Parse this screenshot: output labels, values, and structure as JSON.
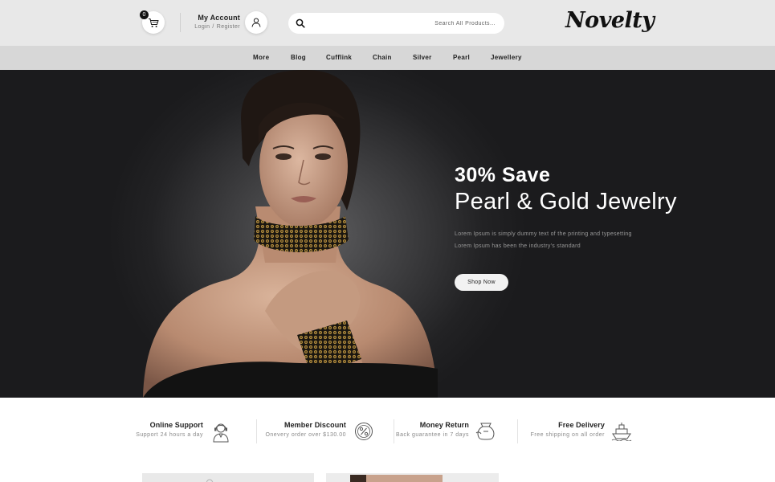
{
  "header": {
    "cart_count": "0",
    "account_title": "My Account",
    "login_label": "Login",
    "link_separator": "/",
    "register_label": "Register",
    "search_placeholder": "Search All Products...",
    "logo_text": "Novelty"
  },
  "nav": {
    "items": [
      {
        "label": "More"
      },
      {
        "label": "Blog"
      },
      {
        "label": "Cufflink"
      },
      {
        "label": "Chain"
      },
      {
        "label": "Silver"
      },
      {
        "label": "Pearl"
      },
      {
        "label": "Jewellery"
      }
    ]
  },
  "hero": {
    "save_text": "30% Save",
    "title": "Pearl & Gold Jewelry",
    "line1": "Lorem Ipsum is simply dummy text of the printing and typesetting",
    "line2": "Lorem Ipsum has been the industry's standard",
    "button_label": "Shop Now"
  },
  "features": [
    {
      "title": "Online Support",
      "subtitle": "Support 24 hours a day",
      "icon": "support-icon"
    },
    {
      "title": "Member Discount",
      "subtitle": "Onevery order over $130.00",
      "icon": "discount-icon"
    },
    {
      "title": "Money Return",
      "subtitle": "Back guarantee in 7 days",
      "icon": "money-bag-icon"
    },
    {
      "title": "Free Delivery",
      "subtitle": "Free shipping on all order",
      "icon": "ship-icon"
    }
  ],
  "colors": {
    "header_bg": "#e8e8e8",
    "nav_bg": "#d7d7d7",
    "hero_bg": "#222224",
    "accent": "#111111",
    "necklace_gold": "#b08a3c"
  }
}
